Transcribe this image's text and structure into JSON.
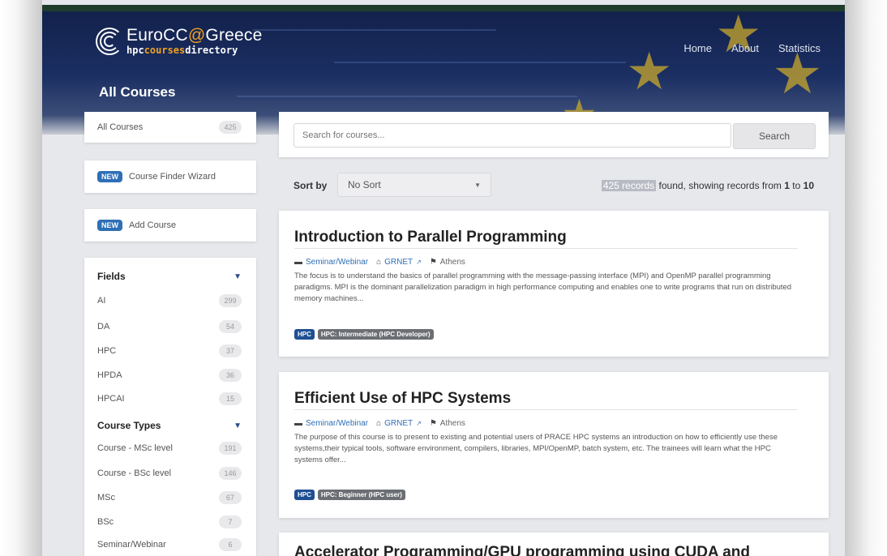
{
  "brand": {
    "title_main": "EuroCC",
    "title_at": "@",
    "title_end": "Greece",
    "sub_hpc": "hpc",
    "sub_courses": "courses",
    "sub_directory": "directory"
  },
  "nav": {
    "items": [
      "Home",
      "About",
      "Statistics"
    ]
  },
  "page_title": "All Courses",
  "sidebar": {
    "all_courses": {
      "label": "All Courses",
      "count": "425"
    },
    "finder": {
      "badge": "NEW",
      "label": "Course Finder Wizard"
    },
    "add": {
      "badge": "NEW",
      "label": "Add Course"
    },
    "fields": {
      "heading": "Fields",
      "items": [
        {
          "label": "AI",
          "count": "299"
        },
        {
          "label": "DA",
          "count": "54"
        },
        {
          "label": "HPC",
          "count": "37"
        },
        {
          "label": "HPDA",
          "count": "36"
        },
        {
          "label": "HPCAI",
          "count": "15"
        }
      ]
    },
    "course_types": {
      "heading": "Course Types",
      "items": [
        {
          "label": "Course - MSc level",
          "count": "191"
        },
        {
          "label": "Course - BSc level",
          "count": "146"
        },
        {
          "label": "MSc",
          "count": "67"
        },
        {
          "label": "BSc",
          "count": "7"
        },
        {
          "label": "Seminar/Webinar",
          "count": "6"
        }
      ]
    }
  },
  "search": {
    "placeholder": "Search for courses...",
    "button": "Search"
  },
  "sort": {
    "label": "Sort by",
    "value": "No Sort"
  },
  "records": {
    "total": "425 records",
    "text_mid": " found, showing records from ",
    "from": "1",
    "text_to": " to ",
    "to": "10"
  },
  "courses": [
    {
      "title": "Introduction to Parallel Programming",
      "type": "Seminar/Webinar",
      "org": "GRNET",
      "location": "Athens",
      "description": "The focus is to understand the basics of parallel programming with the message-passing interface (MPI) and OpenMP parallel programming paradigms. MPI is the dominant parallelization paradigm in high performance computing and enables one to write programs that run on distributed memory machines...",
      "tag_field": "HPC",
      "tag_level": "HPC: Intermediate (HPC Developer)"
    },
    {
      "title": "Efficient Use of HPC Systems",
      "type": "Seminar/Webinar",
      "org": "GRNET",
      "location": "Athens",
      "description": "The purpose of this course is to present to existing and potential users of PRACE HPC systems an introduction on how to efficiently use these systems,their typical tools, software environment, compilers, libraries, MPI/OpenMP, batch system, etc. The trainees will learn what the HPC systems offer...",
      "tag_field": "HPC",
      "tag_level": "HPC: Beginner (HPC user)"
    },
    {
      "title": "Accelerator Programming/GPU programming using CUDA and"
    }
  ],
  "colors": {
    "accent": "#2f6fb6",
    "hero": "#1b2f63",
    "logo_highlight": "#f0a020"
  },
  "icons": [
    "folder-icon",
    "institution-icon",
    "external-link-icon",
    "location-icon",
    "filter-icon",
    "chevron-down-icon"
  ]
}
